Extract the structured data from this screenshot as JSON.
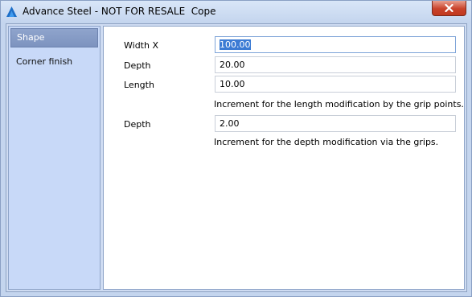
{
  "window": {
    "title": "Advance Steel - NOT FOR RESALE  Cope",
    "icons": {
      "app": "advance-steel-logo-icon",
      "close": "close-icon"
    }
  },
  "sidebar": {
    "items": [
      {
        "label": "Shape",
        "selected": true
      },
      {
        "label": "Corner finish",
        "selected": false
      }
    ]
  },
  "form": {
    "width_x": {
      "label": "Width X",
      "value": "100.00"
    },
    "depth": {
      "label": "Depth",
      "value": "20.00"
    },
    "length": {
      "label": "Length",
      "value": "10.00"
    },
    "length_hint": "Increment for the length modification by the grip points.",
    "depth_increment": {
      "label": "Depth",
      "value": "2.00"
    },
    "depth_hint": "Increment for the depth modification via the grips."
  },
  "colors": {
    "selection": "#3b7bd4",
    "close_button": "#c9432b",
    "sidebar_bg": "#c8d9f8"
  }
}
